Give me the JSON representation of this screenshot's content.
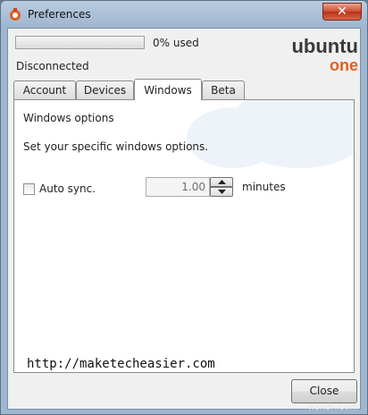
{
  "window": {
    "title": "Preferences",
    "close_glyph": "✕"
  },
  "account": {
    "usage_label": "0% used",
    "usage_fraction": 0.0,
    "status": "Disconnected"
  },
  "logo": {
    "line1": "ubuntu",
    "line2": "one",
    "color1": "#3a3a3a",
    "color2": "#e0601f"
  },
  "tabs": [
    {
      "label": "Account"
    },
    {
      "label": "Devices"
    },
    {
      "label": "Windows"
    },
    {
      "label": "Beta"
    }
  ],
  "active_tab": "Windows",
  "windows_panel": {
    "heading": "Windows options",
    "description": "Set your specific windows options.",
    "auto_sync": {
      "label": "Auto sync.",
      "checked": false
    },
    "interval": {
      "value": "1.00",
      "units": "minutes"
    }
  },
  "footer": {
    "url": "http://maketecheasier.com",
    "close_label": "Close"
  },
  "watermark": "wsxdn.com"
}
